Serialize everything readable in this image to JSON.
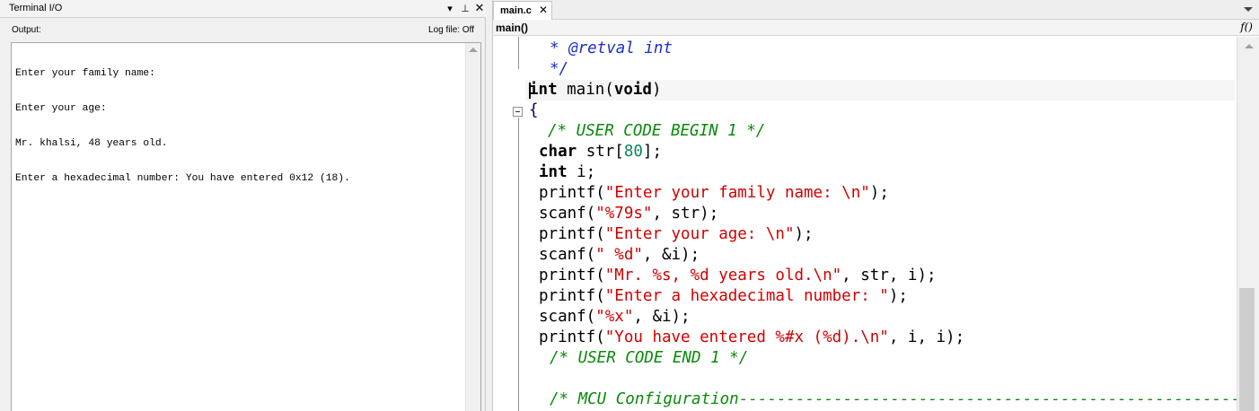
{
  "terminal": {
    "title": "Terminal I/O",
    "menu_icon": "▾",
    "pin_icon": "⊥",
    "close_icon": "✕",
    "output_label": "Output:",
    "logfile_label": "Log file: Off",
    "lines": [
      "Enter your family name:",
      "Enter your age:",
      "Mr. khalsi, 48 years old.",
      "Enter a hexadecimal number: You have entered 0x12 (18)."
    ]
  },
  "editor": {
    "tab_label": "main.c",
    "tab_close": "✕",
    "function_name": "main()",
    "function_icon": "f()",
    "code": {
      "retval_comment": "* @retval int",
      "comment_close": "*/",
      "signature": "int main(void)",
      "open_brace": "{",
      "user_code_begin": "/* USER CODE BEGIN 1 */",
      "decl_char": "char str[80];",
      "decl_int": "int i;",
      "printf_family": "printf(\"Enter your family name: \\n\");",
      "scanf_str": "scanf(\"%79s\", str);",
      "printf_age": "printf(\"Enter your age: \\n\");",
      "scanf_int": "scanf(\" %d\", &i);",
      "printf_mr": "printf(\"Mr. %s, %d years old.\\n\", str, i);",
      "printf_hex_prompt": "printf(\"Enter a hexadecimal number: \");",
      "scanf_hex": "scanf(\"%x\", &i);",
      "printf_result": "printf(\"You have entered %#x (%d).\\n\", i, i);",
      "user_code_end": "/* USER CODE END 1 */",
      "mcu_config": "/* MCU Configuration------------------------------------------------------"
    }
  },
  "colors": {
    "keyword": "#000000",
    "string": "#d00000",
    "comment": "#0a8a0a",
    "comment_keyword": "#1a2fc7",
    "number": "#098658"
  }
}
